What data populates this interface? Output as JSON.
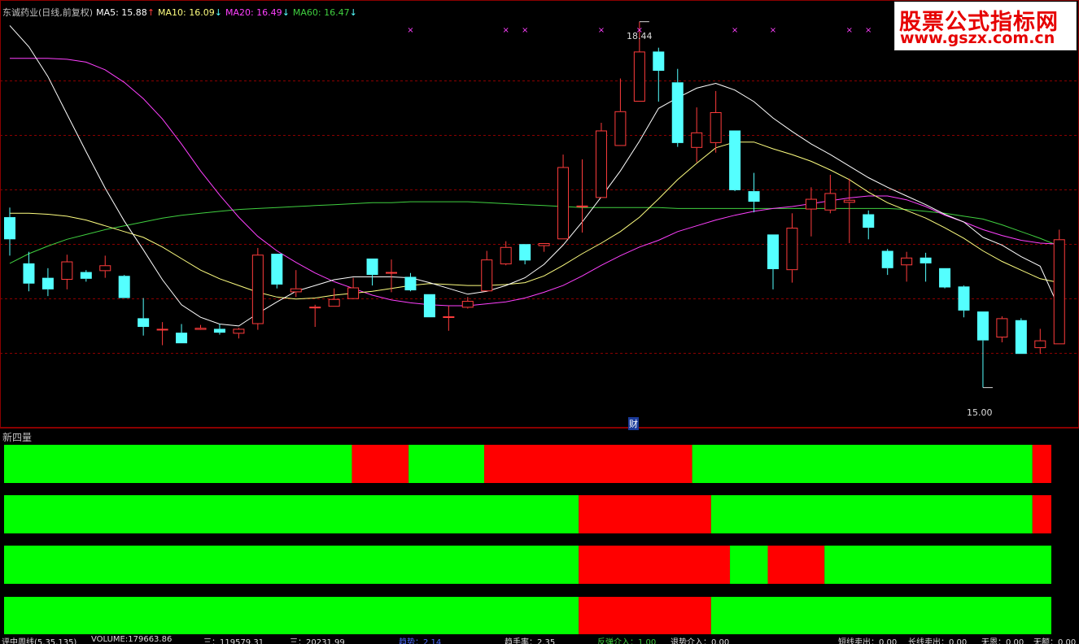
{
  "legend": {
    "title": "东诚药业(日线,前复权)",
    "ma5": "MA5: 15.88",
    "ma5_arrow": "↑",
    "ma10": "MA10: 16.09",
    "ma10_arrow": "↓",
    "ma20": "MA20: 16.49",
    "ma20_arrow": "↓",
    "ma60": "MA60: 16.47",
    "ma60_arrow": "↓"
  },
  "colors": {
    "up": "#ff3c3c",
    "down": "#54ffff",
    "ma5": "#ffffff",
    "ma10": "#ffff80",
    "ma20": "#ff40ff",
    "ma60": "#40d040",
    "grid": "#8b0000",
    "strip_green": "#00ff00",
    "strip_red": "#ff0000"
  },
  "annotations": {
    "high": "18.44",
    "low": "15.00",
    "finance_marker": "财"
  },
  "watermark": {
    "line1": "股票公式指标网",
    "line2": "www.gszx.com.cn"
  },
  "indicator": {
    "title": "新四量",
    "strips": [
      [
        [
          "g",
          0,
          92
        ],
        [
          "r",
          92,
          107
        ],
        [
          "g",
          107,
          127
        ],
        [
          "r",
          127,
          182
        ],
        [
          "g",
          182,
          272
        ],
        [
          "r",
          272,
          277
        ]
      ],
      [
        [
          "g",
          0,
          152
        ],
        [
          "r",
          152,
          187
        ],
        [
          "g",
          187,
          272
        ],
        [
          "r",
          272,
          277
        ]
      ],
      [
        [
          "g",
          0,
          152
        ],
        [
          "r",
          152,
          192
        ],
        [
          "g",
          192,
          202
        ],
        [
          "r",
          202,
          217
        ],
        [
          "g",
          217,
          277
        ]
      ],
      [
        [
          "g",
          0,
          152
        ],
        [
          "r",
          152,
          187
        ],
        [
          "g",
          187,
          277
        ]
      ]
    ]
  },
  "bottom_bar": [
    "评中周线(5,35,135)",
    "VOLUME:179663.86",
    "三：119579.31",
    "三：20231.99",
    "趋势：2.14",
    "趋手率：2.35",
    "反弹介入：1.00",
    "退势介入：0.00",
    "短线卖出：0.00",
    "长线卖出：0.00",
    "无恩：0.00",
    "无额：0.00"
  ],
  "chart_data": {
    "type": "candlestick",
    "ylim": [
      14.6,
      19.0
    ],
    "candles": [
      [
        16.77,
        16.54,
        16.87,
        16.37
      ],
      [
        16.29,
        16.08,
        16.41,
        16.0
      ],
      [
        16.14,
        16.02,
        16.24,
        15.95
      ],
      [
        16.12,
        16.31,
        16.38,
        16.02
      ],
      [
        16.2,
        16.13,
        16.22,
        16.1
      ],
      [
        16.21,
        16.27,
        16.37,
        16.14
      ],
      [
        16.16,
        15.93,
        16.17,
        15.93
      ],
      [
        15.72,
        15.63,
        15.93,
        15.54
      ],
      [
        15.61,
        15.61,
        15.68,
        15.44
      ],
      [
        15.57,
        15.46,
        15.66,
        15.46
      ],
      [
        15.6,
        15.62,
        15.65,
        15.61
      ],
      [
        15.61,
        15.57,
        15.66,
        15.55
      ],
      [
        15.56,
        15.61,
        15.62,
        15.51
      ],
      [
        15.66,
        16.38,
        16.45,
        15.6
      ],
      [
        16.39,
        16.07,
        16.39,
        16.03
      ],
      [
        15.99,
        16.03,
        16.22,
        15.94
      ],
      [
        15.83,
        15.84,
        15.86,
        15.63
      ],
      [
        15.84,
        15.92,
        16.03,
        15.84
      ],
      [
        15.92,
        16.04,
        16.14,
        15.93
      ],
      [
        16.34,
        16.17,
        16.34,
        16.06
      ],
      [
        16.2,
        16.2,
        16.33,
        15.99
      ],
      [
        16.15,
        16.01,
        16.19,
        16.0
      ],
      [
        15.97,
        15.73,
        15.97,
        15.73
      ],
      [
        15.74,
        15.74,
        15.85,
        15.59
      ],
      [
        15.83,
        15.9,
        15.94,
        15.82
      ],
      [
        16.0,
        16.33,
        16.42,
        16.0
      ],
      [
        16.28,
        16.46,
        16.52,
        16.27
      ],
      [
        16.49,
        16.32,
        16.49,
        16.28
      ],
      [
        16.47,
        16.5,
        16.49,
        16.41
      ],
      [
        16.54,
        17.29,
        17.42,
        16.54
      ],
      [
        16.89,
        16.89,
        17.37,
        16.61
      ],
      [
        16.97,
        17.67,
        17.75,
        16.97
      ],
      [
        17.51,
        17.87,
        18.21,
        17.51
      ],
      [
        17.97,
        18.49,
        18.8,
        17.97
      ],
      [
        18.49,
        18.29,
        18.53,
        17.97
      ],
      [
        18.17,
        17.54,
        18.31,
        17.5
      ],
      [
        17.49,
        17.65,
        17.91,
        17.34
      ],
      [
        17.54,
        17.86,
        18.08,
        17.44
      ],
      [
        17.67,
        17.05,
        17.67,
        17.04
      ],
      [
        17.04,
        16.93,
        17.23,
        16.82
      ],
      [
        16.59,
        16.23,
        16.59,
        16.02
      ],
      [
        16.22,
        16.66,
        16.81,
        16.09
      ],
      [
        16.85,
        16.96,
        17.08,
        16.57
      ],
      [
        16.84,
        17.02,
        17.21,
        16.81
      ],
      [
        16.92,
        16.95,
        17.17,
        16.5
      ],
      [
        16.8,
        16.66,
        16.84,
        16.54
      ],
      [
        16.42,
        16.24,
        16.44,
        16.17
      ],
      [
        16.27,
        16.35,
        16.41,
        16.1
      ],
      [
        16.35,
        16.29,
        16.4,
        16.1
      ],
      [
        16.24,
        16.04,
        16.24,
        16.03
      ],
      [
        16.05,
        15.8,
        16.06,
        15.73
      ],
      [
        15.79,
        15.49,
        15.79,
        15.0
      ],
      [
        15.52,
        15.72,
        15.74,
        15.47
      ],
      [
        15.7,
        15.35,
        15.72,
        15.35
      ],
      [
        15.41,
        15.49,
        15.61,
        15.35
      ],
      [
        15.45,
        16.54,
        16.64,
        15.45
      ]
    ],
    "ma5": [
      18.76,
      18.54,
      18.23,
      17.84,
      17.45,
      17.07,
      16.73,
      16.43,
      16.12,
      15.86,
      15.73,
      15.66,
      15.64,
      15.77,
      15.89,
      16.0,
      16.06,
      16.12,
      16.15,
      16.15,
      16.15,
      16.14,
      16.09,
      16.03,
      15.97,
      16.0,
      16.06,
      16.14,
      16.28,
      16.48,
      16.72,
      16.98,
      17.25,
      17.56,
      17.9,
      18.01,
      18.11,
      18.16,
      18.09,
      17.97,
      17.8,
      17.66,
      17.53,
      17.42,
      17.3,
      17.18,
      17.08,
      16.99,
      16.9,
      16.8,
      16.72,
      16.56,
      16.48,
      16.36,
      16.26,
      15.82
    ],
    "ma10": [
      16.81,
      16.81,
      16.8,
      16.78,
      16.74,
      16.68,
      16.62,
      16.56,
      16.46,
      16.34,
      16.22,
      16.13,
      16.06,
      15.99,
      15.94,
      15.92,
      15.93,
      15.96,
      15.98,
      16.0,
      16.03,
      16.06,
      16.08,
      16.07,
      16.06,
      16.06,
      16.07,
      16.09,
      16.16,
      16.27,
      16.39,
      16.5,
      16.62,
      16.77,
      16.96,
      17.16,
      17.33,
      17.49,
      17.55,
      17.55,
      17.48,
      17.42,
      17.35,
      17.26,
      17.16,
      17.03,
      16.92,
      16.84,
      16.76,
      16.66,
      16.55,
      16.42,
      16.31,
      16.22,
      16.13,
      16.09
    ],
    "ma20": [
      18.42,
      18.42,
      18.42,
      18.41,
      18.38,
      18.3,
      18.17,
      18.0,
      17.79,
      17.53,
      17.25,
      17.0,
      16.77,
      16.57,
      16.42,
      16.3,
      16.19,
      16.1,
      16.03,
      15.96,
      15.91,
      15.88,
      15.86,
      15.85,
      15.85,
      15.87,
      15.89,
      15.93,
      15.99,
      16.06,
      16.16,
      16.27,
      16.37,
      16.46,
      16.53,
      16.62,
      16.68,
      16.74,
      16.79,
      16.83,
      16.86,
      16.88,
      16.91,
      16.94,
      16.97,
      16.99,
      16.99,
      16.95,
      16.88,
      16.79,
      16.72,
      16.64,
      16.58,
      16.53,
      16.5,
      16.49
    ],
    "ma60": [
      16.29,
      16.39,
      16.47,
      16.54,
      16.59,
      16.64,
      16.68,
      16.72,
      16.76,
      16.79,
      16.81,
      16.83,
      16.85,
      16.86,
      16.87,
      16.88,
      16.89,
      16.9,
      16.91,
      16.92,
      16.92,
      16.93,
      16.93,
      16.93,
      16.93,
      16.92,
      16.91,
      16.9,
      16.89,
      16.88,
      16.87,
      16.87,
      16.87,
      16.87,
      16.87,
      16.86,
      16.86,
      16.86,
      16.86,
      16.86,
      16.86,
      16.86,
      16.86,
      16.86,
      16.86,
      16.86,
      16.86,
      16.85,
      16.83,
      16.81,
      16.78,
      16.75,
      16.69,
      16.62,
      16.55,
      16.47
    ],
    "signal_marks": [
      21,
      26,
      27,
      31,
      33,
      38,
      40,
      44,
      45
    ]
  }
}
